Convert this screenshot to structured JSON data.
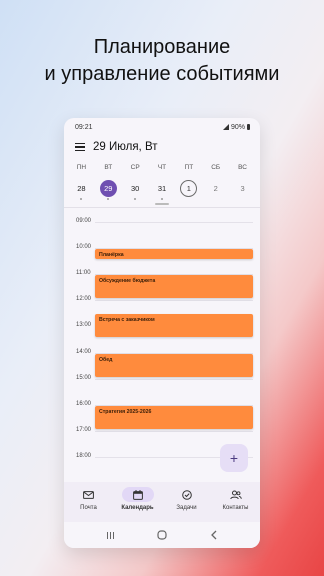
{
  "headline": {
    "line1": "Планирование",
    "line2": "и управление событиями"
  },
  "status_bar": {
    "time": "09:21",
    "battery": "90%"
  },
  "app_bar": {
    "title": "29 Июля, Вт",
    "menu_icon": "hamburger-menu-icon"
  },
  "week": {
    "days": [
      "ПН",
      "ВТ",
      "СР",
      "ЧТ",
      "ПТ",
      "СБ",
      "ВС"
    ],
    "dates": [
      {
        "num": "28",
        "state": "normal",
        "dot": true
      },
      {
        "num": "29",
        "state": "today",
        "dot": true
      },
      {
        "num": "30",
        "state": "normal",
        "dot": true
      },
      {
        "num": "31",
        "state": "normal",
        "dot": true
      },
      {
        "num": "1",
        "state": "selected",
        "dot": false
      },
      {
        "num": "2",
        "state": "muted",
        "dot": false
      },
      {
        "num": "3",
        "state": "muted",
        "dot": false
      }
    ]
  },
  "timeline": {
    "hours": [
      "09:00",
      "10:00",
      "11:00",
      "12:00",
      "13:00",
      "14:00",
      "15:00",
      "16:00",
      "17:00",
      "18:00"
    ],
    "events": [
      {
        "title": "Планёрка",
        "start": "10:00",
        "end": "10:30"
      },
      {
        "title": "Обсуждение бюджета",
        "start": "11:00",
        "end": "12:00"
      },
      {
        "title": "Встреча с заказчиком",
        "start": "12:30",
        "end": "13:30"
      },
      {
        "title": "Обед",
        "start": "14:00",
        "end": "15:00"
      },
      {
        "title": "Стратегия 2025-2026",
        "start": "16:00",
        "end": "17:00"
      }
    ],
    "event_color": "#ff8b3d"
  },
  "fab": {
    "label": "+",
    "icon": "plus-icon"
  },
  "bottom_nav": [
    {
      "label": "Почта",
      "icon": "mail-icon",
      "active": false
    },
    {
      "label": "Календарь",
      "icon": "calendar-icon",
      "active": true
    },
    {
      "label": "Задачи",
      "icon": "check-circle-icon",
      "active": false
    },
    {
      "label": "Контакты",
      "icon": "contacts-icon",
      "active": false
    }
  ],
  "system_nav": [
    "recents-icon",
    "home-icon",
    "back-icon"
  ],
  "colors": {
    "accent": "#6f4fb1",
    "event": "#ff8b3d",
    "nav_active_bg": "#e2d8f6"
  }
}
